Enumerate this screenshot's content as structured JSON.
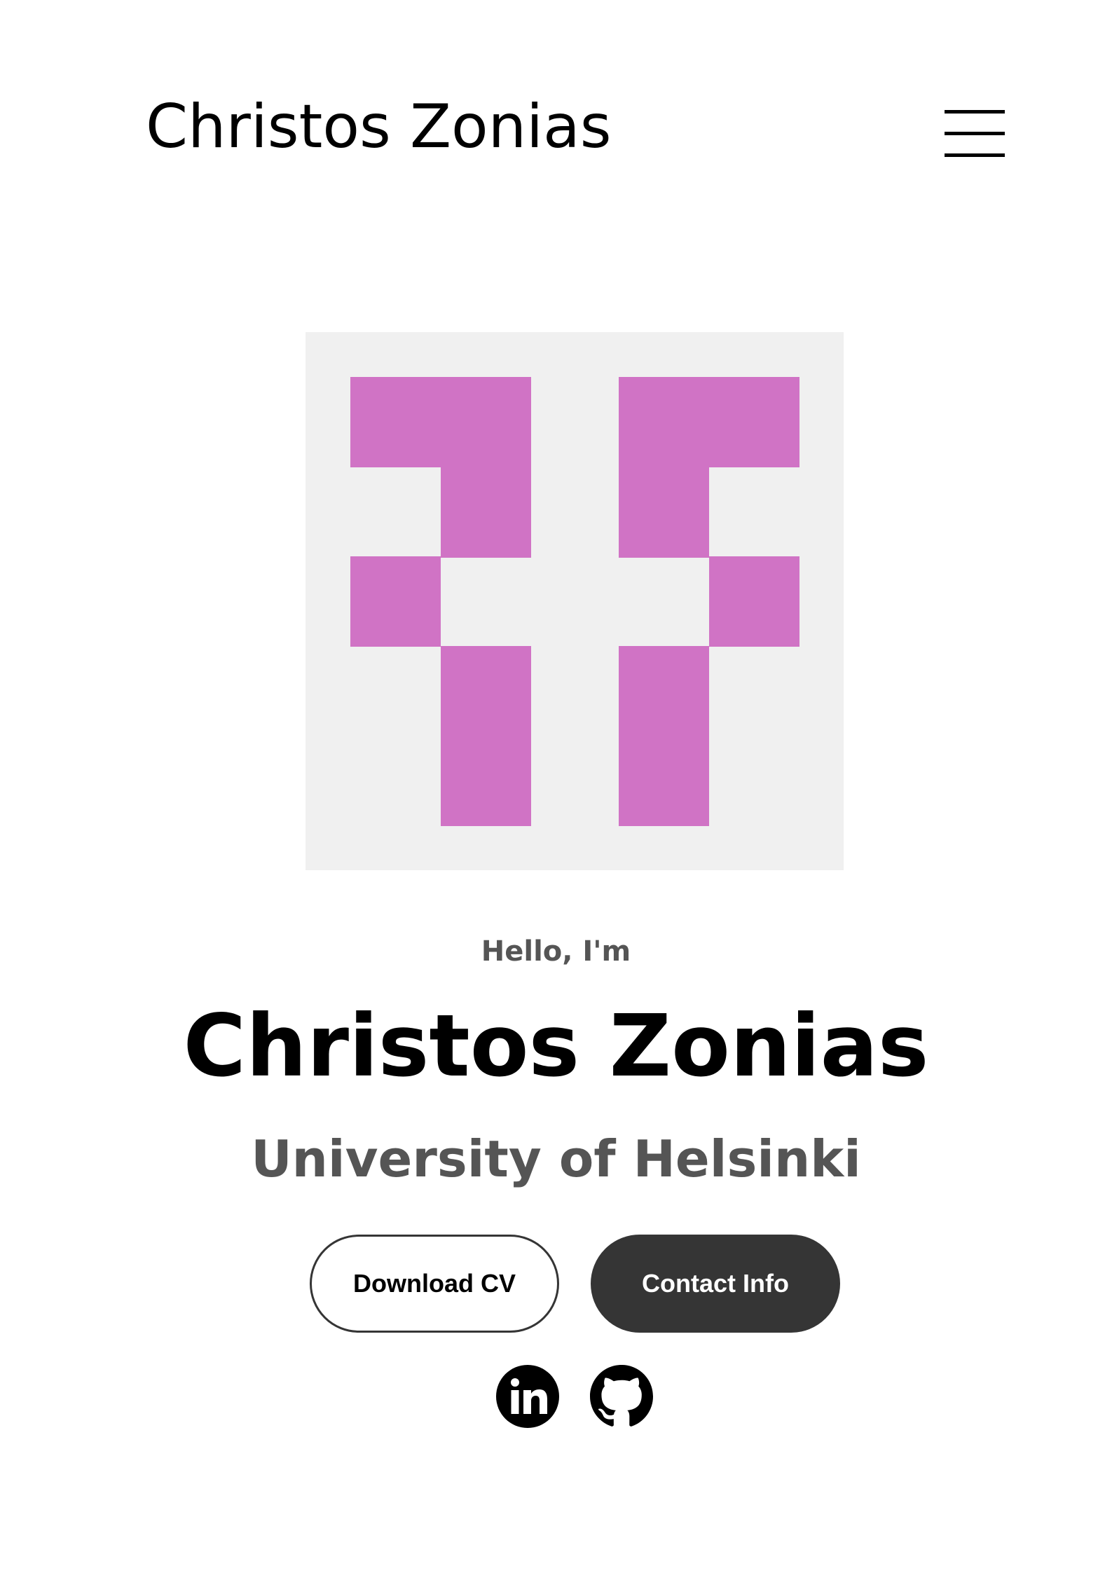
{
  "nav": {
    "brand": "Christos Zonias",
    "menu_icon": "hamburger-menu-icon"
  },
  "avatar": {
    "icon": "pixel-identicon",
    "background_color": "#f0f0f0",
    "pixel_color": "#d073c5"
  },
  "profile": {
    "greeting": "Hello, I'm",
    "name": "Christos Zonias",
    "affiliation": "University of Helsinki"
  },
  "buttons": {
    "download_cv": "Download CV",
    "contact_info": "Contact Info"
  },
  "social": {
    "linkedin_icon": "linkedin-icon",
    "github_icon": "github-icon"
  },
  "colors": {
    "primary_dark": "#353535",
    "muted_text": "#555555",
    "text": "#000000"
  }
}
